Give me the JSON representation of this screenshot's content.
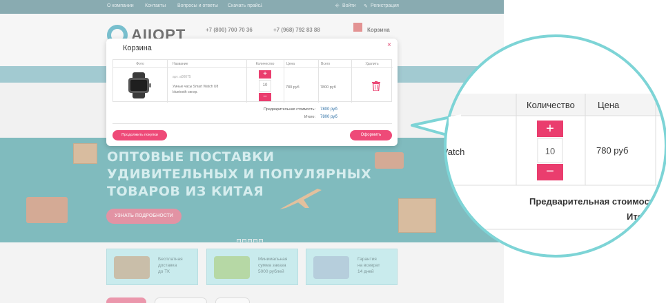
{
  "topnav": {
    "about": "О компании",
    "contacts": "Контакты",
    "faq": "Вопросы и ответы",
    "download": "Скачать прайс",
    "login": "Войти",
    "register": "Регистрация"
  },
  "header": {
    "logo_text": "AIIOPT",
    "phone1": "+7 (800) 700 70 36",
    "phone2": "+7 (968) 792 83 88",
    "cart_label": "Корзина"
  },
  "banner": {
    "line1": "ОПТОВЫЕ ПОСТАВКИ",
    "line2": "УДИВИТЕЛЬНЫХ И ПОПУЛЯРНЫХ",
    "line3": "ТОВАРОВ ИЗ КИТАЯ",
    "button": "УЗНАТЬ ПОДРОБНОСТИ"
  },
  "features": [
    {
      "l1": "Бесплатная",
      "l2": "доставка",
      "l3": "до ТК"
    },
    {
      "l1": "Минимальная",
      "l2": "сумма заказа",
      "l3": "5000 рублей"
    },
    {
      "l1": "Гарантия",
      "l2": "на возврат",
      "l3": "14 дней"
    }
  ],
  "modal": {
    "title": "Корзина",
    "close": "×",
    "columns": {
      "photo": "Фото",
      "name": "Название",
      "qty": "Количество",
      "price": "Цена",
      "total": "Всего",
      "delete": "Удалить"
    },
    "item": {
      "article": "арт. a00075",
      "name": "Умные часы Smart Watch U8 bluetooth синхр.",
      "qty": "10",
      "price": "780 руб",
      "total": "7800 руб"
    },
    "pre_total_label": "Предварительная стоимость:",
    "pre_total_value": "7800 руб",
    "total_label": "Итого:",
    "total_value": "7800 руб",
    "continue_button": "Продолжить покупки",
    "order_button": "Оформить"
  },
  "zoom": {
    "col_qty": "Количество",
    "col_price": "Цена",
    "name_fragment": "Watch",
    "plus": "+",
    "minus": "−",
    "qty": "10",
    "price": "780 руб",
    "pre_total_label": "Предварительная стоимость:",
    "total_label": "Итого"
  },
  "colors": {
    "accent": "#ea3d6e",
    "callout_ring": "#7dd4d6",
    "link_blue": "#2d6fa5"
  }
}
